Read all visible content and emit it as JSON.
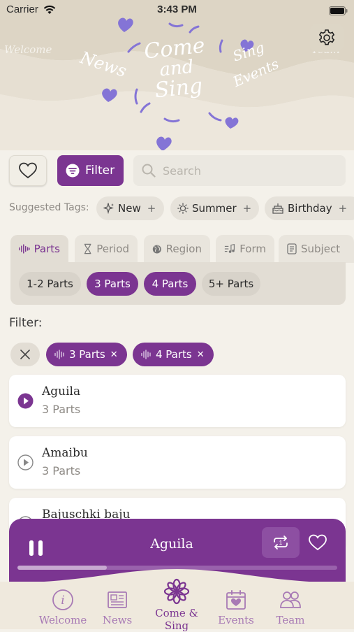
{
  "status_bar": {
    "carrier": "Carrier",
    "time": "3:43 PM"
  },
  "header": {
    "logo_lines": [
      "Come",
      "and",
      "Sing"
    ],
    "words": [
      "Welcome",
      "News",
      "Sing",
      "Events",
      "Team"
    ]
  },
  "toolbar": {
    "filter_label": "Filter",
    "search_placeholder": "Search"
  },
  "suggested_tags": {
    "label": "Suggested Tags:",
    "items": [
      {
        "label": "New",
        "icon": "sparkles-icon"
      },
      {
        "label": "Summer",
        "icon": "sun-icon"
      },
      {
        "label": "Birthday",
        "icon": "cake-icon"
      }
    ]
  },
  "category_tabs": [
    {
      "label": "Parts",
      "icon": "waveform-icon",
      "active": true
    },
    {
      "label": "Period",
      "icon": "hourglass-icon",
      "active": false
    },
    {
      "label": "Region",
      "icon": "globe-icon",
      "active": false
    },
    {
      "label": "Form",
      "icon": "music-note-icon",
      "active": false
    },
    {
      "label": "Subject",
      "icon": "document-icon",
      "active": false
    }
  ],
  "parts_options": [
    {
      "label": "1-2 Parts",
      "selected": false
    },
    {
      "label": "3 Parts",
      "selected": true
    },
    {
      "label": "4 Parts",
      "selected": true
    },
    {
      "label": "5+ Parts",
      "selected": false
    }
  ],
  "filter": {
    "label": "Filter:",
    "active": [
      {
        "label": "3 Parts"
      },
      {
        "label": "4 Parts"
      }
    ]
  },
  "songs": [
    {
      "title": "Aguila",
      "subtitle": "3 Parts",
      "playing": true
    },
    {
      "title": "Amaibu",
      "subtitle": "3 Parts",
      "playing": false
    },
    {
      "title": "Bajuschki baju",
      "subtitle": "",
      "playing": false
    }
  ],
  "player": {
    "title": "Aguila",
    "progress": 0.28
  },
  "tab_bar": [
    {
      "label": "Welcome",
      "icon": "info-icon",
      "active": false
    },
    {
      "label": "News",
      "icon": "newspaper-icon",
      "active": false
    },
    {
      "label": "Come & Sing",
      "icon": "flower-icon",
      "active": true
    },
    {
      "label": "Events",
      "icon": "calendar-heart-icon",
      "active": false
    },
    {
      "label": "Team",
      "icon": "people-icon",
      "active": false
    }
  ],
  "colors": {
    "accent": "#7b3591",
    "background": "#f4f1ea",
    "chip": "#e6e2da"
  }
}
